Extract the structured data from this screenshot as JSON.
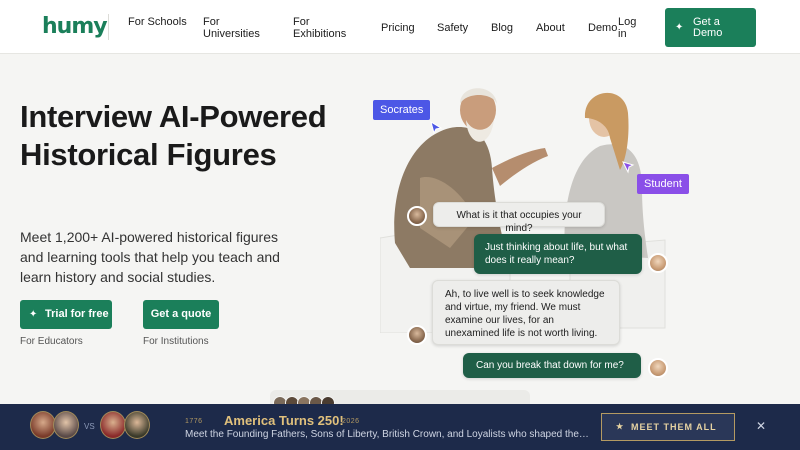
{
  "brand": {
    "logo_text": "humy"
  },
  "nav": {
    "links": [
      {
        "label": "For Schools"
      },
      {
        "label": "For Universities"
      },
      {
        "label": "For Exhibitions"
      },
      {
        "label": "Pricing"
      },
      {
        "label": "Safety"
      },
      {
        "label": "Blog"
      },
      {
        "label": "About"
      },
      {
        "label": "Demo"
      },
      {
        "label": "Log in"
      }
    ],
    "cta": "Get a Demo"
  },
  "hero": {
    "title": "Interview AI-Powered Historical Figures",
    "subtitle": "Meet 1,200+ AI-powered historical figures and learning tools that help you teach and learn history and social studies.",
    "primary_cta": "Trial for free",
    "primary_caption": "For Educators",
    "secondary_cta": "Get a quote",
    "secondary_caption": "For Institutions"
  },
  "scene": {
    "tag_left": "Socrates",
    "tag_right": "Student",
    "messages": [
      {
        "from": "socrates",
        "text": "What is it that occupies your mind?"
      },
      {
        "from": "student",
        "text": "Just thinking about life, but what does it really mean?"
      },
      {
        "from": "socrates",
        "text": "Ah, to live well is to seek knowledge and virtue, my friend. We must examine our lives, for an unexamined life is not worth living."
      },
      {
        "from": "student",
        "text": "Can you break that down for me?"
      }
    ]
  },
  "banner": {
    "vs": "VS",
    "year_start": "1776",
    "year_end": "2026",
    "title": "America Turns 250!",
    "subtitle": "Meet the Founding Fathers, Sons of Liberty, British Crown, and Loyalists who shaped the America...",
    "button": "MEET THEM ALL",
    "close": "✕"
  },
  "icons": {
    "spark": "sparkle-icon",
    "star": "star-icon",
    "close": "close-icon",
    "pointer": "cursor-pointer-icon"
  },
  "colors": {
    "brand_green": "#1b7f5a",
    "bubble_dark": "#1f5e47",
    "tag_socrates": "#4c57e6",
    "tag_student": "#8a4fe8",
    "banner_bg": "#1d2a4a",
    "banner_gold": "#e0c07c"
  }
}
